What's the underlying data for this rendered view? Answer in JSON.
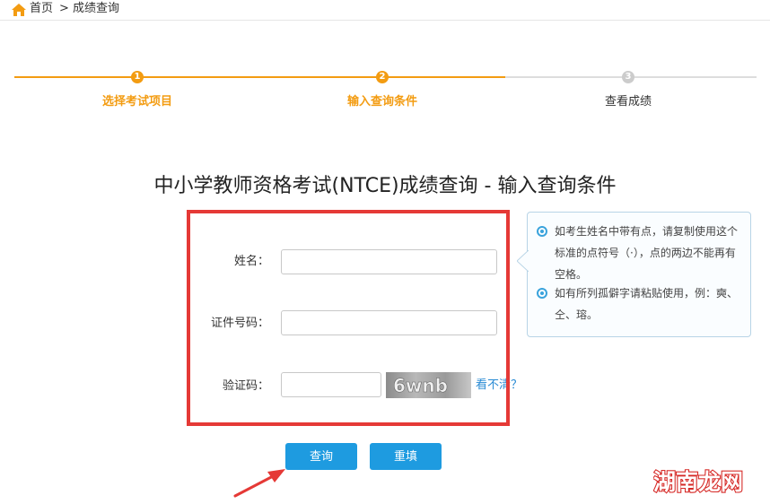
{
  "breadcrumb": {
    "home": "首页",
    "separator": ">",
    "current": "成绩查询"
  },
  "steps": [
    {
      "number": "1",
      "label": "选择考试项目",
      "state": "done"
    },
    {
      "number": "2",
      "label": "输入查询条件",
      "state": "active"
    },
    {
      "number": "3",
      "label": "查看成绩",
      "state": "pending"
    }
  ],
  "title": "中小学教师资格考试(NTCE)成绩查询 - 输入查询条件",
  "form": {
    "name_label": "姓名：",
    "name_value": "",
    "id_label": "证件号码：",
    "id_value": "",
    "captcha_label": "验证码：",
    "captcha_value": "",
    "captcha_image_text": "6wnb",
    "captcha_refresh": "看不清？"
  },
  "tips": [
    "如考生姓名中带有点，请复制使用这个标准的点符号（·），点的两边不能再有空格。",
    "如有所列孤僻字请粘贴使用，例：奭、仝、瑢。"
  ],
  "buttons": {
    "query": "查询",
    "reset": "重填"
  },
  "watermark": "湖南龙网",
  "colors": {
    "accent_orange": "#f39c12",
    "primary_blue": "#1e9be0",
    "highlight_red": "#e53936",
    "inactive_gray": "#cccccc"
  }
}
